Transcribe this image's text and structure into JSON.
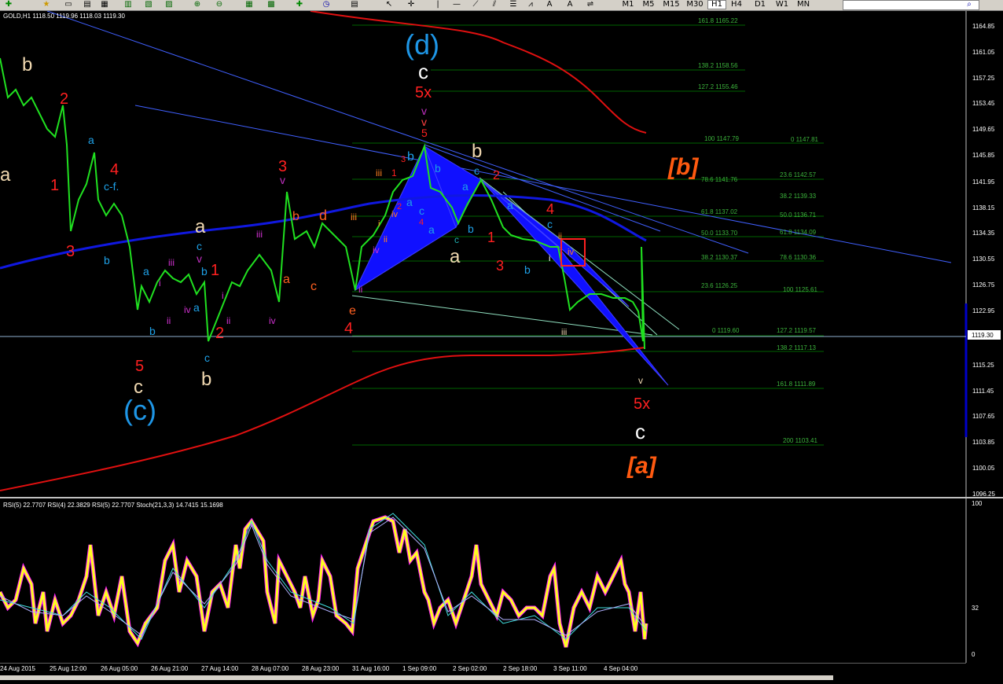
{
  "toolbar": {
    "timeframes": [
      "M1",
      "M5",
      "M15",
      "M30",
      "H1",
      "H4",
      "D1",
      "W1",
      "MN"
    ],
    "active_timeframe": "H1",
    "icons": [
      "new-order-icon",
      "favorites-icon",
      "file-icon",
      "chart-icon",
      "chart2-icon",
      "zoom-in-icon",
      "zoom-out-icon",
      "grid-icon",
      "autoscroll-icon",
      "add-indicator-icon",
      "period-icon",
      "template-icon",
      "cursor-icon",
      "crosshair-icon",
      "vertical-line-icon",
      "horizontal-line-icon",
      "trendline-icon",
      "channel-icon",
      "fibo-icon",
      "gann-icon",
      "text-icon",
      "label-icon",
      "arrow-icon",
      "search-icon"
    ],
    "text_tools": [
      "A",
      "A"
    ]
  },
  "chart": {
    "header": "GOLD,H1  1118.50 1119.96 1118.03 1119.30",
    "current_price": "1119.30",
    "price_ticks": [
      "1164.85",
      "1161.05",
      "1157.25",
      "1153.45",
      "1149.65",
      "1145.85",
      "1141.95",
      "1138.15",
      "1134.35",
      "1130.55",
      "1126.75",
      "1122.95",
      "1119.15",
      "1115.25",
      "1111.45",
      "1107.65",
      "1103.85",
      "1100.05",
      "1096.25"
    ],
    "fib_labels_left": [
      "161.8 1165.22",
      "138.2 1158.56",
      "127.2 1155.46",
      "100 1147.79",
      "78.6 1141.76",
      "61.8 1137.02",
      "50.0 1133.70",
      "38.2 1130.37",
      "23.6 1126.25",
      "0 1119.60"
    ],
    "fib_labels_right": [
      "0 1147.81",
      "23.6 1142.57",
      "38.2 1139.33",
      "50.0 1136.71",
      "61.8 1134.09",
      "78.6 1130.36",
      "100 1125.61",
      "127.2 1119.57",
      "138.2 1117.13",
      "161.8 1111.89",
      "200 1103.41"
    ],
    "wave_labels": {
      "d_big": "(d)",
      "c_big": "(c)",
      "b_bracket": "[b]",
      "a_bracket": "[a]",
      "c_top": "c",
      "x5_top": "5x",
      "v_top1": "v",
      "v_top2": "v",
      "five_top": "5",
      "a_left": "a",
      "b_left": "b",
      "two_left": "2",
      "one_left": "1",
      "four_left": "4",
      "three_left": "3",
      "a_cyan": "a",
      "cf_cyan": "c-f.",
      "b_cyan": "b",
      "five_bottom": "5",
      "c_bottom": "c",
      "a_mid": "a",
      "c_mid": "c",
      "v_mid": "v",
      "b_mid_c": "b",
      "one_mid": "1",
      "iii_1": "iii",
      "i_1": "i",
      "ii_1": "ii",
      "iv_1": "iv",
      "a_c2": "a",
      "b_c2": "b",
      "c_c2": "c",
      "b_mid": "b",
      "i_2": "i",
      "ii_2": "ii",
      "two_mid": "2",
      "three_mid": "3",
      "v_mid2": "v",
      "iii_2": "iii",
      "iv_2": "iv",
      "a_or": "a",
      "b_or": "b",
      "c_or": "c",
      "d_or": "d",
      "e_or": "e",
      "four_mid": "4",
      "iii_or": "iii",
      "ii_mag": "ii",
      "iii_sm": "iii",
      "one_sm": "1",
      "three_sm": "3",
      "two_sm": "2",
      "iv_sm": "iv",
      "i_sm": "i",
      "ii_sm": "ii",
      "iv_mag": "iv",
      "four_sm": "4",
      "b_cy3": "b",
      "a_cy3": "a",
      "c_cy3": "c",
      "a_cy4": "a",
      "b_top": "b",
      "a_wh": "a",
      "c_cy5": "c",
      "a_cy5": "a",
      "b_cy5": "b",
      "c_cy6": "c",
      "two_red": "2",
      "one_red": "1",
      "three_red": "3",
      "b_cy6": "b",
      "a_cy7": "a",
      "four_red": "4",
      "c_cy7": "c",
      "ii_or": "ii",
      "i_w": "i",
      "iv_or": "iv",
      "iii_w": "iii",
      "v_bot": "v",
      "x5_bot": "5x",
      "c_bot": "c"
    }
  },
  "indicator": {
    "header": "RSI(5) 22.7707  RSI(4) 22.3829  RSI(5) 22.7707  Stoch(21,3,3) 14.7415 15.1698",
    "ticks": [
      "100",
      "32",
      "0"
    ]
  },
  "xaxis": {
    "labels": [
      "24 Aug 2015",
      "25 Aug 12:00",
      "26 Aug 05:00",
      "26 Aug 21:00",
      "27 Aug 14:00",
      "28 Aug 07:00",
      "28 Aug 23:00",
      "31 Aug 16:00",
      "1 Sep 09:00",
      "2 Sep 02:00",
      "2 Sep 18:00",
      "3 Sep 11:00",
      "4 Sep 04:00"
    ]
  }
}
